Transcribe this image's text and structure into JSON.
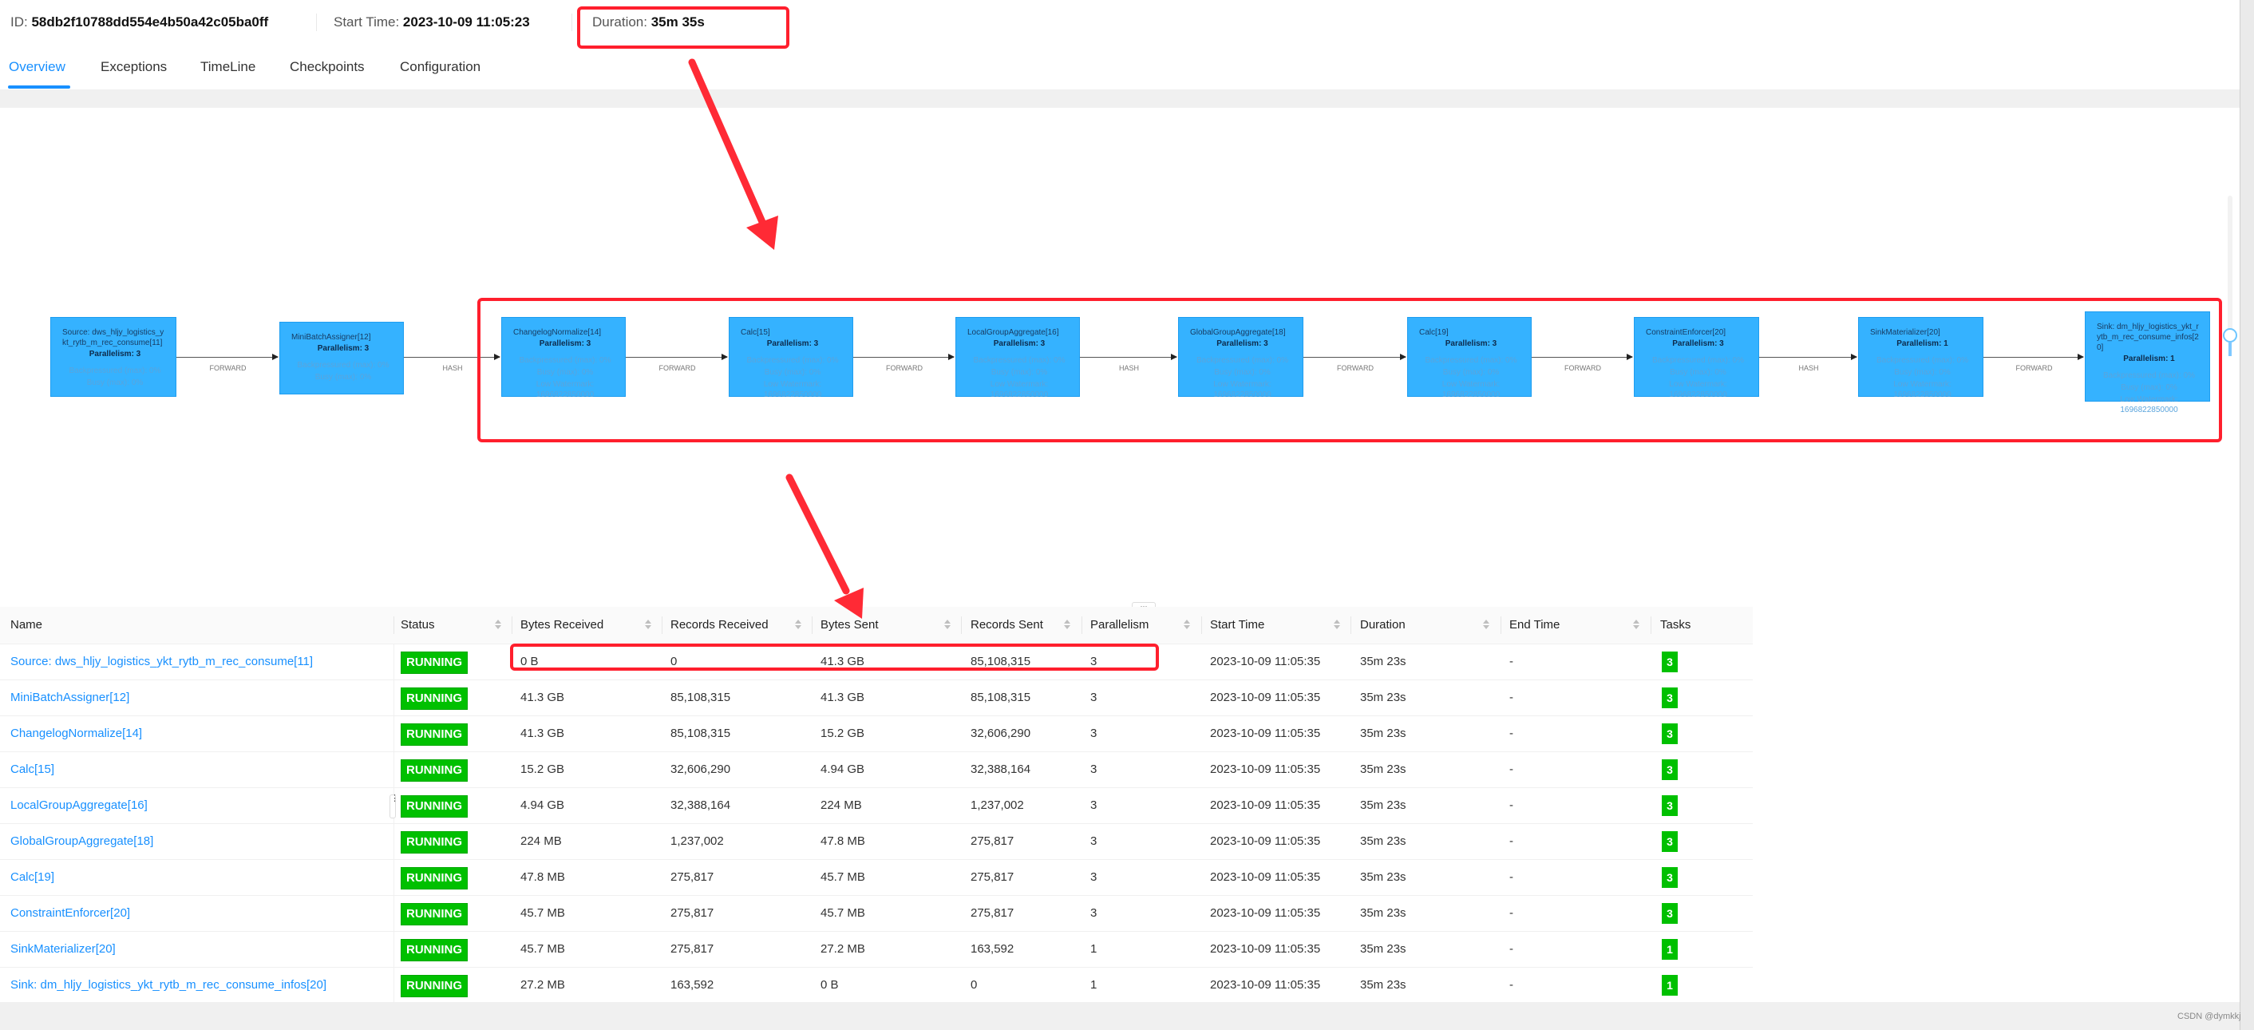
{
  "header": {
    "id_label": "ID:",
    "id_value": "58db2f10788dd554e4b50a42c05ba0ff",
    "start_label": "Start Time:",
    "start_value": "2023-10-09 11:05:23",
    "duration_label": "Duration:",
    "duration_value": "35m 35s"
  },
  "tabs": [
    {
      "label": "Overview",
      "active": true
    },
    {
      "label": "Exceptions",
      "active": false
    },
    {
      "label": "TimeLine",
      "active": false
    },
    {
      "label": "Checkpoints",
      "active": false
    },
    {
      "label": "Configuration",
      "active": false
    }
  ],
  "graph": {
    "nodes": [
      {
        "title": "Source: dws_hljy_logistics_ykt_rytb_m_rec_consume[11]",
        "parallelism": "Parallelism: 3",
        "metrics": [
          "Backpressured (max): 0%",
          "Busy (max): 0%"
        ]
      },
      {
        "title": "MiniBatchAssigner[12]",
        "parallelism": "Parallelism: 3",
        "metrics": [
          "Backpressured (max): 0%",
          "Busy (max): 0%"
        ]
      },
      {
        "title": "ChangelogNormalize[14]",
        "parallelism": "Parallelism: 3",
        "metrics": [
          "Backpressured (max): 0%",
          "Busy (max): 0%",
          "Low Watermark: 1696822850000"
        ]
      },
      {
        "title": "Calc[15]",
        "parallelism": "Parallelism: 3",
        "metrics": [
          "Backpressured (max): 0%",
          "Busy (max): 0%",
          "Low Watermark: 1696822850000"
        ]
      },
      {
        "title": "LocalGroupAggregate[16]",
        "parallelism": "Parallelism: 3",
        "metrics": [
          "Backpressured (max): 0%",
          "Busy (max): 0%",
          "Low Watermark: 1696822850000"
        ]
      },
      {
        "title": "GlobalGroupAggregate[18]",
        "parallelism": "Parallelism: 3",
        "metrics": [
          "Backpressured (max): 0%",
          "Busy (max): 0%",
          "Low Watermark: 1696822850000"
        ]
      },
      {
        "title": "Calc[19]",
        "parallelism": "Parallelism: 3",
        "metrics": [
          "Backpressured (max): 0%",
          "Busy (max): 0%",
          "Low Watermark: 1696822850000"
        ]
      },
      {
        "title": "ConstraintEnforcer[20]",
        "parallelism": "Parallelism: 3",
        "metrics": [
          "Backpressured (max): 0%",
          "Busy (max): 0%",
          "Low Watermark: 1696822850000"
        ]
      },
      {
        "title": "SinkMaterializer[20]",
        "parallelism": "Parallelism: 1",
        "metrics": [
          "Backpressured (max): 0%",
          "Busy (max): 0%",
          "Low Watermark: 1696822850000"
        ]
      },
      {
        "title": "Sink: dm_hljy_logistics_ykt_rytb_m_rec_consume_infos[20]",
        "parallelism": "Parallelism: 1",
        "metrics": [
          "Backpressured (max): 0%",
          "Busy (max): 0%",
          "Low Watermark: 1696822850000"
        ]
      }
    ],
    "edges": [
      "FORWARD",
      "HASH",
      "FORWARD",
      "FORWARD",
      "HASH",
      "FORWARD",
      "FORWARD",
      "HASH",
      "FORWARD"
    ]
  },
  "table": {
    "columns": [
      "Name",
      "Status",
      "Bytes Received",
      "Records Received",
      "Bytes Sent",
      "Records Sent",
      "Parallelism",
      "Start Time",
      "Duration",
      "End Time",
      "Tasks"
    ],
    "rows": [
      {
        "name": "Source: dws_hljy_logistics_ykt_rytb_m_rec_consume[11]",
        "status": "RUNNING",
        "bytes_received": "0 B",
        "records_received": "0",
        "bytes_sent": "41.3 GB",
        "records_sent": "85,108,315",
        "parallelism": "3",
        "start_time": "2023-10-09 11:05:35",
        "duration": "35m 23s",
        "end_time": "-",
        "tasks": "3"
      },
      {
        "name": "MiniBatchAssigner[12]",
        "status": "RUNNING",
        "bytes_received": "41.3 GB",
        "records_received": "85,108,315",
        "bytes_sent": "41.3 GB",
        "records_sent": "85,108,315",
        "parallelism": "3",
        "start_time": "2023-10-09 11:05:35",
        "duration": "35m 23s",
        "end_time": "-",
        "tasks": "3"
      },
      {
        "name": "ChangelogNormalize[14]",
        "status": "RUNNING",
        "bytes_received": "41.3 GB",
        "records_received": "85,108,315",
        "bytes_sent": "15.2 GB",
        "records_sent": "32,606,290",
        "parallelism": "3",
        "start_time": "2023-10-09 11:05:35",
        "duration": "35m 23s",
        "end_time": "-",
        "tasks": "3"
      },
      {
        "name": "Calc[15]",
        "status": "RUNNING",
        "bytes_received": "15.2 GB",
        "records_received": "32,606,290",
        "bytes_sent": "4.94 GB",
        "records_sent": "32,388,164",
        "parallelism": "3",
        "start_time": "2023-10-09 11:05:35",
        "duration": "35m 23s",
        "end_time": "-",
        "tasks": "3"
      },
      {
        "name": "LocalGroupAggregate[16]",
        "status": "RUNNING",
        "bytes_received": "4.94 GB",
        "records_received": "32,388,164",
        "bytes_sent": "224 MB",
        "records_sent": "1,237,002",
        "parallelism": "3",
        "start_time": "2023-10-09 11:05:35",
        "duration": "35m 23s",
        "end_time": "-",
        "tasks": "3"
      },
      {
        "name": "GlobalGroupAggregate[18]",
        "status": "RUNNING",
        "bytes_received": "224 MB",
        "records_received": "1,237,002",
        "bytes_sent": "47.8 MB",
        "records_sent": "275,817",
        "parallelism": "3",
        "start_time": "2023-10-09 11:05:35",
        "duration": "35m 23s",
        "end_time": "-",
        "tasks": "3"
      },
      {
        "name": "Calc[19]",
        "status": "RUNNING",
        "bytes_received": "47.8 MB",
        "records_received": "275,817",
        "bytes_sent": "45.7 MB",
        "records_sent": "275,817",
        "parallelism": "3",
        "start_time": "2023-10-09 11:05:35",
        "duration": "35m 23s",
        "end_time": "-",
        "tasks": "3"
      },
      {
        "name": "ConstraintEnforcer[20]",
        "status": "RUNNING",
        "bytes_received": "45.7 MB",
        "records_received": "275,817",
        "bytes_sent": "45.7 MB",
        "records_sent": "275,817",
        "parallelism": "3",
        "start_time": "2023-10-09 11:05:35",
        "duration": "35m 23s",
        "end_time": "-",
        "tasks": "3"
      },
      {
        "name": "SinkMaterializer[20]",
        "status": "RUNNING",
        "bytes_received": "45.7 MB",
        "records_received": "275,817",
        "bytes_sent": "27.2 MB",
        "records_sent": "163,592",
        "parallelism": "1",
        "start_time": "2023-10-09 11:05:35",
        "duration": "35m 23s",
        "end_time": "-",
        "tasks": "1"
      },
      {
        "name": "Sink: dm_hljy_logistics_ykt_rytb_m_rec_consume_infos[20]",
        "status": "RUNNING",
        "bytes_received": "27.2 MB",
        "records_received": "163,592",
        "bytes_sent": "0 B",
        "records_sent": "0",
        "parallelism": "1",
        "start_time": "2023-10-09 11:05:35",
        "duration": "35m 23s",
        "end_time": "-",
        "tasks": "1"
      }
    ]
  },
  "divider_handle": "···",
  "watermark": "CSDN @dymkkj",
  "colors": {
    "accent": "#1890ff",
    "node_fill": "#35b2ff",
    "running": "#00c000",
    "annotation": "#ff1f2d"
  }
}
